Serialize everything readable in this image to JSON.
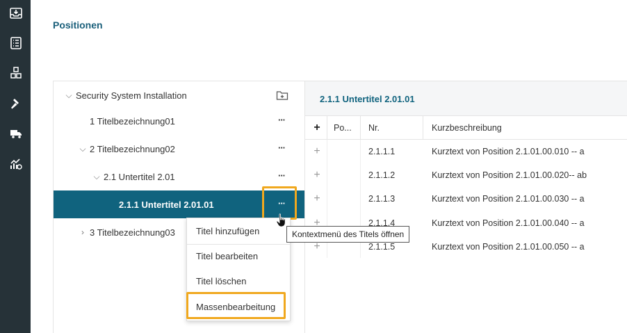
{
  "sidebar": {
    "icons": [
      "inbox-download-icon",
      "checklist-icon",
      "boxes-icon",
      "hammer-icon",
      "truck-icon",
      "chart-trend-icon"
    ]
  },
  "page": {
    "title": "Positionen"
  },
  "tree": {
    "items": [
      {
        "label": "Security System Installation",
        "chevron": "⌵",
        "level": 0
      },
      {
        "label": "1 Titelbezeichnung01",
        "chevron": "",
        "level": 1
      },
      {
        "label": "2 Titelbezeichnung02",
        "chevron": "⌵",
        "level": 1
      },
      {
        "label": "2.1 Untertitel 2.01",
        "chevron": "⌵",
        "level": 2
      },
      {
        "label": "2.1.1 Untertitel 2.01.01",
        "chevron": "",
        "level": 3,
        "selected": true
      },
      {
        "label": "3 Titelbezeichnung03",
        "chevron": "›",
        "level": 1
      }
    ],
    "more_label": "···"
  },
  "tooltip": {
    "text": "Kontextmenü des Titels öffnen"
  },
  "context_menu": {
    "items": [
      "Titel hinzufügen",
      "Titel bearbeiten",
      "Titel löschen",
      "Massenbearbeitung"
    ]
  },
  "detail": {
    "title": "2.1.1 Untertitel 2.01.01",
    "add_symbol": "+",
    "columns": {
      "po": "Po...",
      "nr": "Nr.",
      "kurz": "Kurzbeschreibung"
    },
    "rows": [
      {
        "nr": "2.1.1.1",
        "text": "Kurztext von Position 2.1.01.00.010 -- a"
      },
      {
        "nr": "2.1.1.2",
        "text": "Kurztext von Position 2.1.01.00.020-- ab"
      },
      {
        "nr": "2.1.1.3",
        "text": "Kurztext von Position 2.1.01.00.030 -- a"
      },
      {
        "nr": "2.1.1.4",
        "text": "Kurztext von Position 2.1.01.00.040 -- a"
      },
      {
        "nr": "2.1.1.5",
        "text": "Kurztext von Position 2.1.01.00.050 -- a"
      }
    ]
  },
  "colors": {
    "accent": "#10637e",
    "highlight": "#f0a81e",
    "sidebar": "#263238"
  }
}
